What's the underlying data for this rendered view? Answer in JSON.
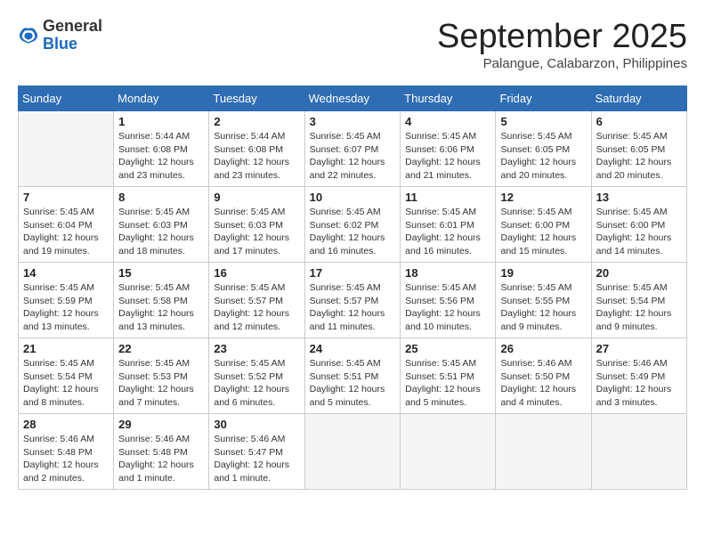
{
  "header": {
    "logo_general": "General",
    "logo_blue": "Blue",
    "month_title": "September 2025",
    "location": "Palangue, Calabarzon, Philippines"
  },
  "days_of_week": [
    "Sunday",
    "Monday",
    "Tuesday",
    "Wednesday",
    "Thursday",
    "Friday",
    "Saturday"
  ],
  "weeks": [
    [
      {
        "day": "",
        "info": ""
      },
      {
        "day": "1",
        "info": "Sunrise: 5:44 AM\nSunset: 6:08 PM\nDaylight: 12 hours\nand 23 minutes."
      },
      {
        "day": "2",
        "info": "Sunrise: 5:44 AM\nSunset: 6:08 PM\nDaylight: 12 hours\nand 23 minutes."
      },
      {
        "day": "3",
        "info": "Sunrise: 5:45 AM\nSunset: 6:07 PM\nDaylight: 12 hours\nand 22 minutes."
      },
      {
        "day": "4",
        "info": "Sunrise: 5:45 AM\nSunset: 6:06 PM\nDaylight: 12 hours\nand 21 minutes."
      },
      {
        "day": "5",
        "info": "Sunrise: 5:45 AM\nSunset: 6:05 PM\nDaylight: 12 hours\nand 20 minutes."
      },
      {
        "day": "6",
        "info": "Sunrise: 5:45 AM\nSunset: 6:05 PM\nDaylight: 12 hours\nand 20 minutes."
      }
    ],
    [
      {
        "day": "7",
        "info": "Sunrise: 5:45 AM\nSunset: 6:04 PM\nDaylight: 12 hours\nand 19 minutes."
      },
      {
        "day": "8",
        "info": "Sunrise: 5:45 AM\nSunset: 6:03 PM\nDaylight: 12 hours\nand 18 minutes."
      },
      {
        "day": "9",
        "info": "Sunrise: 5:45 AM\nSunset: 6:03 PM\nDaylight: 12 hours\nand 17 minutes."
      },
      {
        "day": "10",
        "info": "Sunrise: 5:45 AM\nSunset: 6:02 PM\nDaylight: 12 hours\nand 16 minutes."
      },
      {
        "day": "11",
        "info": "Sunrise: 5:45 AM\nSunset: 6:01 PM\nDaylight: 12 hours\nand 16 minutes."
      },
      {
        "day": "12",
        "info": "Sunrise: 5:45 AM\nSunset: 6:00 PM\nDaylight: 12 hours\nand 15 minutes."
      },
      {
        "day": "13",
        "info": "Sunrise: 5:45 AM\nSunset: 6:00 PM\nDaylight: 12 hours\nand 14 minutes."
      }
    ],
    [
      {
        "day": "14",
        "info": "Sunrise: 5:45 AM\nSunset: 5:59 PM\nDaylight: 12 hours\nand 13 minutes."
      },
      {
        "day": "15",
        "info": "Sunrise: 5:45 AM\nSunset: 5:58 PM\nDaylight: 12 hours\nand 13 minutes."
      },
      {
        "day": "16",
        "info": "Sunrise: 5:45 AM\nSunset: 5:57 PM\nDaylight: 12 hours\nand 12 minutes."
      },
      {
        "day": "17",
        "info": "Sunrise: 5:45 AM\nSunset: 5:57 PM\nDaylight: 12 hours\nand 11 minutes."
      },
      {
        "day": "18",
        "info": "Sunrise: 5:45 AM\nSunset: 5:56 PM\nDaylight: 12 hours\nand 10 minutes."
      },
      {
        "day": "19",
        "info": "Sunrise: 5:45 AM\nSunset: 5:55 PM\nDaylight: 12 hours\nand 9 minutes."
      },
      {
        "day": "20",
        "info": "Sunrise: 5:45 AM\nSunset: 5:54 PM\nDaylight: 12 hours\nand 9 minutes."
      }
    ],
    [
      {
        "day": "21",
        "info": "Sunrise: 5:45 AM\nSunset: 5:54 PM\nDaylight: 12 hours\nand 8 minutes."
      },
      {
        "day": "22",
        "info": "Sunrise: 5:45 AM\nSunset: 5:53 PM\nDaylight: 12 hours\nand 7 minutes."
      },
      {
        "day": "23",
        "info": "Sunrise: 5:45 AM\nSunset: 5:52 PM\nDaylight: 12 hours\nand 6 minutes."
      },
      {
        "day": "24",
        "info": "Sunrise: 5:45 AM\nSunset: 5:51 PM\nDaylight: 12 hours\nand 5 minutes."
      },
      {
        "day": "25",
        "info": "Sunrise: 5:45 AM\nSunset: 5:51 PM\nDaylight: 12 hours\nand 5 minutes."
      },
      {
        "day": "26",
        "info": "Sunrise: 5:46 AM\nSunset: 5:50 PM\nDaylight: 12 hours\nand 4 minutes."
      },
      {
        "day": "27",
        "info": "Sunrise: 5:46 AM\nSunset: 5:49 PM\nDaylight: 12 hours\nand 3 minutes."
      }
    ],
    [
      {
        "day": "28",
        "info": "Sunrise: 5:46 AM\nSunset: 5:48 PM\nDaylight: 12 hours\nand 2 minutes."
      },
      {
        "day": "29",
        "info": "Sunrise: 5:46 AM\nSunset: 5:48 PM\nDaylight: 12 hours\nand 1 minute."
      },
      {
        "day": "30",
        "info": "Sunrise: 5:46 AM\nSunset: 5:47 PM\nDaylight: 12 hours\nand 1 minute."
      },
      {
        "day": "",
        "info": ""
      },
      {
        "day": "",
        "info": ""
      },
      {
        "day": "",
        "info": ""
      },
      {
        "day": "",
        "info": ""
      }
    ]
  ]
}
